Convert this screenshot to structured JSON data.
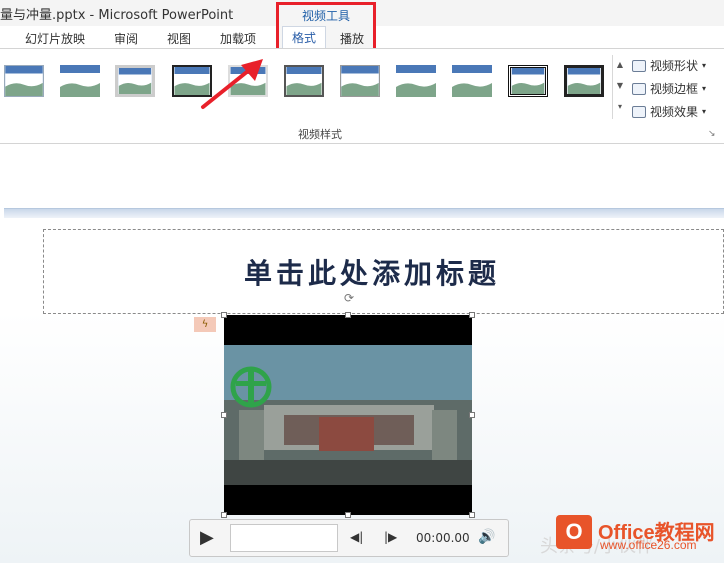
{
  "window": {
    "title": "量与冲量.pptx - Microsoft PowerPoint",
    "contextual_group": "视频工具"
  },
  "tabs": [
    {
      "label": "幻灯片放映"
    },
    {
      "label": "审阅"
    },
    {
      "label": "视图"
    },
    {
      "label": "加载项"
    },
    {
      "label": "格式",
      "active": true
    },
    {
      "label": "播放"
    }
  ],
  "ribbon": {
    "group_label": "视频样式",
    "style_thumbnails": [
      {
        "name": "style-1"
      },
      {
        "name": "style-2"
      },
      {
        "name": "style-3"
      },
      {
        "name": "style-4"
      },
      {
        "name": "style-5"
      },
      {
        "name": "style-6"
      },
      {
        "name": "style-7"
      },
      {
        "name": "style-8"
      },
      {
        "name": "style-9"
      },
      {
        "name": "style-10"
      },
      {
        "name": "style-11"
      }
    ],
    "options": [
      {
        "label": "视频形状",
        "icon": "shape-icon"
      },
      {
        "label": "视频边框",
        "icon": "pen-icon"
      },
      {
        "label": "视频效果",
        "icon": "effects-icon"
      }
    ],
    "highlight_color": "#e8202a"
  },
  "slide": {
    "title_placeholder": "单击此处添加标题"
  },
  "media_controls": {
    "time": "00:00.00"
  },
  "watermark": {
    "logo_letter": "O",
    "title": "Office教程网",
    "url": "www.office26.com",
    "overlay_text": "头条号/小伙伴"
  }
}
